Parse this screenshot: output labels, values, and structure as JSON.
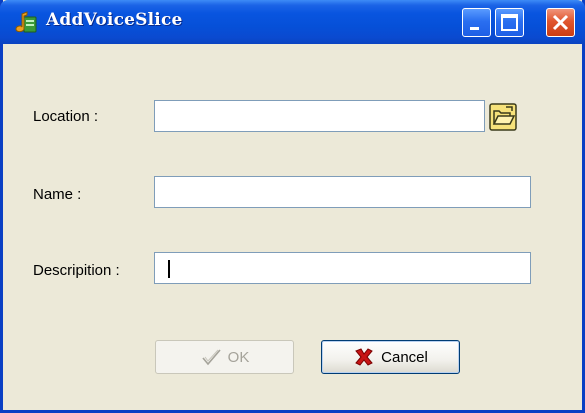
{
  "window": {
    "title": "AddVoiceSlice"
  },
  "titlebar_buttons": {
    "minimize_icon": "minimize-icon",
    "maximize_icon": "maximize-icon",
    "close_icon": "close-icon"
  },
  "form": {
    "location_label": "Location :",
    "location_value": "",
    "name_label": "Name :",
    "name_value": "",
    "description_label": "Descripition :",
    "description_value": "",
    "browse_icon": "open-folder-icon"
  },
  "actions": {
    "ok_label": "OK",
    "ok_enabled": false,
    "ok_icon": "checkmark-icon",
    "cancel_label": "Cancel",
    "cancel_icon": "red-x-icon"
  },
  "colors": {
    "titlebar": "#0955e0",
    "dialog_bg": "#ece9d8",
    "close_button": "#e0562e",
    "field_border": "#7f9db9"
  }
}
